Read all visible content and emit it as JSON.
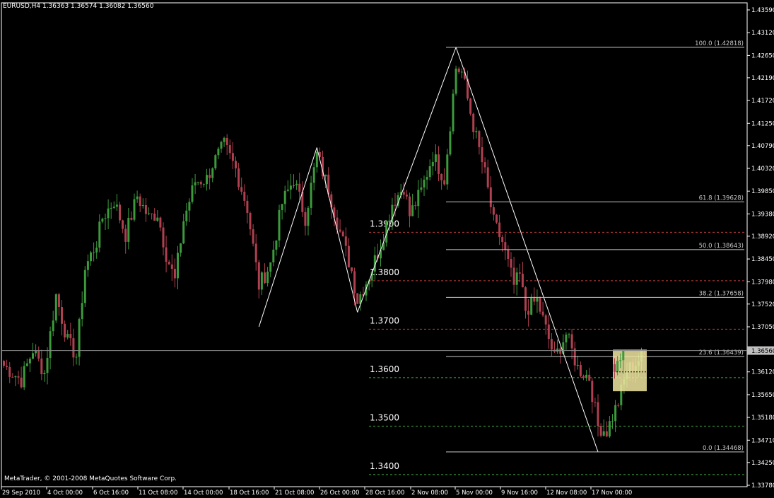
{
  "window": {
    "header": "EURUSD,H4  1.36363 1.36574 1.36082 1.36560",
    "copyright": "MetaTrader, © 2001-2008 MetaQuotes Software Corp."
  },
  "colors": {
    "background": "#000000",
    "axis": "#ffffff",
    "bull": "#3c9a3c",
    "bear": "#b04050",
    "fib": "#c8c8c8",
    "red_level": "#c83c3c",
    "green_level": "#3caa3c",
    "zigzag": "#ffffff",
    "highlight": "#f0e6a0"
  },
  "chart_data": {
    "type": "candlestick",
    "symbol": "EURUSD",
    "timeframe": "H4",
    "ohlc_readout": {
      "open": 1.36363,
      "high": 1.36574,
      "low": 1.36082,
      "close": 1.3656
    },
    "current_price": 1.3656,
    "ylim": [
      1.3378,
      1.4359
    ],
    "y_ticks": [
      "1.43590",
      "1.43120",
      "1.42650",
      "1.42190",
      "1.41720",
      "1.41250",
      "1.40790",
      "1.40320",
      "1.39850",
      "1.39380",
      "1.38920",
      "1.38450",
      "1.37980",
      "1.37520",
      "1.37050",
      "1.36560",
      "1.36120",
      "1.35650",
      "1.35180",
      "1.34710",
      "1.34250",
      "1.33780"
    ],
    "x_ticks": [
      "29 Sep 2010",
      "4 Oct 00:00",
      "6 Oct 16:00",
      "11 Oct 08:00",
      "14 Oct 00:00",
      "18 Oct 16:00",
      "21 Oct 08:00",
      "26 Oct 00:00",
      "28 Oct 16:00",
      "2 Nov 08:00",
      "5 Nov 00:00",
      "9 Nov 16:00",
      "12 Nov 08:00",
      "17 Nov 00:00"
    ],
    "fibonacci": [
      {
        "label": "100.0 (1.42818)",
        "price": 1.42818
      },
      {
        "label": "61.8 (1.39628)",
        "price": 1.39628
      },
      {
        "label": "50.0 (1.38643)",
        "price": 1.38643
      },
      {
        "label": "38.2 (1.37658)",
        "price": 1.37658
      },
      {
        "label": "23.6 (1.36439)",
        "price": 1.36439
      },
      {
        "label": "0.0 (1.34468)",
        "price": 1.34468
      }
    ],
    "round_levels": [
      {
        "label": "1.3900",
        "price": 1.39,
        "color": "red"
      },
      {
        "label": "1.3800",
        "price": 1.38,
        "color": "red"
      },
      {
        "label": "1.3700",
        "price": 1.37,
        "color": "red"
      },
      {
        "label": "1.3600",
        "price": 1.36,
        "color": "green"
      },
      {
        "label": "1.3500",
        "price": 1.35,
        "color": "green"
      },
      {
        "label": "1.3400",
        "price": 1.34,
        "color": "green"
      }
    ],
    "zigzag": [
      {
        "bar": 88,
        "price": 1.3705
      },
      {
        "bar": 108,
        "price": 1.4075
      },
      {
        "bar": 122,
        "price": 1.3735
      },
      {
        "bar": 156,
        "price": 1.42818
      },
      {
        "bar": 205,
        "price": 1.34468
      }
    ],
    "key_points": [
      [
        0,
        1.3625
      ],
      [
        6,
        1.3595
      ],
      [
        10,
        1.3658
      ],
      [
        14,
        1.361
      ],
      [
        18,
        1.377
      ],
      [
        22,
        1.3675
      ],
      [
        25,
        1.3645
      ],
      [
        28,
        1.3825
      ],
      [
        32,
        1.388
      ],
      [
        34,
        1.393
      ],
      [
        38,
        1.3965
      ],
      [
        42,
        1.3895
      ],
      [
        46,
        1.3975
      ],
      [
        50,
        1.393
      ],
      [
        53,
        1.394
      ],
      [
        56,
        1.3855
      ],
      [
        59,
        1.38
      ],
      [
        62,
        1.3925
      ],
      [
        66,
        1.4005
      ],
      [
        70,
        1.401
      ],
      [
        72,
        1.404
      ],
      [
        76,
        1.408
      ],
      [
        80,
        1.403
      ],
      [
        84,
        1.395
      ],
      [
        88,
        1.379
      ],
      [
        92,
        1.3835
      ],
      [
        96,
        1.396
      ],
      [
        100,
        1.401
      ],
      [
        104,
        1.393
      ],
      [
        108,
        1.406
      ],
      [
        112,
        1.399
      ],
      [
        116,
        1.39
      ],
      [
        120,
        1.382
      ],
      [
        122,
        1.376
      ],
      [
        126,
        1.381
      ],
      [
        130,
        1.3875
      ],
      [
        134,
        1.396
      ],
      [
        138,
        1.3995
      ],
      [
        140,
        1.3935
      ],
      [
        144,
        1.3985
      ],
      [
        148,
        1.406
      ],
      [
        152,
        1.401
      ],
      [
        156,
        1.424
      ],
      [
        158,
        1.423
      ],
      [
        162,
        1.412
      ],
      [
        166,
        1.402
      ],
      [
        169,
        1.392
      ],
      [
        172,
        1.388
      ],
      [
        176,
        1.379
      ],
      [
        178,
        1.381
      ],
      [
        180,
        1.374
      ],
      [
        184,
        1.376
      ],
      [
        188,
        1.368
      ],
      [
        190,
        1.364
      ],
      [
        194,
        1.369
      ],
      [
        198,
        1.362
      ],
      [
        202,
        1.36
      ],
      [
        205,
        1.35
      ],
      [
        208,
        1.349
      ],
      [
        212,
        1.355
      ],
      [
        215,
        1.3615
      ],
      [
        218,
        1.363
      ],
      [
        221,
        1.365
      ]
    ]
  }
}
